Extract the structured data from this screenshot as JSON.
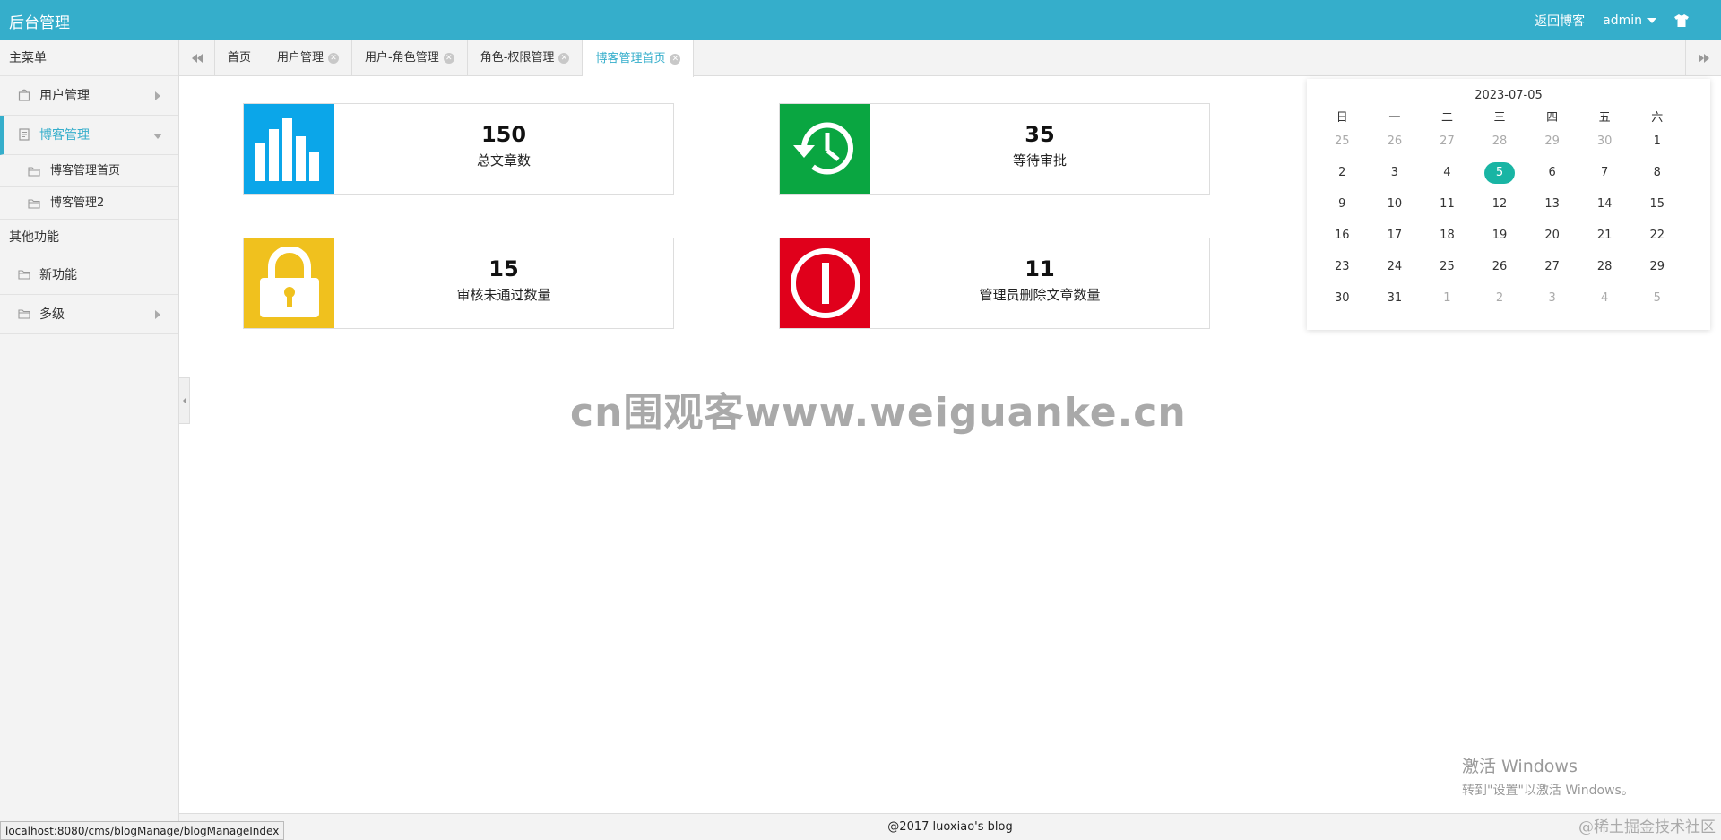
{
  "header": {
    "brand": "后台管理",
    "back_link": "返回博客",
    "user": "admin"
  },
  "sidebar": {
    "main_title": "主菜单",
    "items": [
      {
        "label": "用户管理"
      },
      {
        "label": "博客管理"
      }
    ],
    "blog_sub": [
      {
        "label": "博客管理首页"
      },
      {
        "label": "博客管理2"
      }
    ],
    "other_title": "其他功能",
    "other_items": [
      {
        "label": "新功能"
      },
      {
        "label": "多级"
      }
    ]
  },
  "tabs": [
    {
      "label": "首页"
    },
    {
      "label": "用户管理"
    },
    {
      "label": "用户-角色管理"
    },
    {
      "label": "角色-权限管理"
    },
    {
      "label": "博客管理首页"
    }
  ],
  "stats": [
    {
      "value": "150",
      "label": "总文章数",
      "color": "#0ba6e9"
    },
    {
      "value": "35",
      "label": "等待审批",
      "color": "#0aa641"
    },
    {
      "value": "15",
      "label": "审核未通过数量",
      "color": "#f0c11e"
    },
    {
      "value": "11",
      "label": "管理员删除文章数量",
      "color": "#e0001b"
    }
  ],
  "watermark": "cn围观客www.weiguanke.cn",
  "calendar": {
    "title": "2023-07-05",
    "weekdays": [
      "日",
      "一",
      "二",
      "三",
      "四",
      "五",
      "六"
    ],
    "weeks": [
      [
        "25",
        "26",
        "27",
        "28",
        "29",
        "30",
        "1"
      ],
      [
        "2",
        "3",
        "4",
        "5",
        "6",
        "7",
        "8"
      ],
      [
        "9",
        "10",
        "11",
        "12",
        "13",
        "14",
        "15"
      ],
      [
        "16",
        "17",
        "18",
        "19",
        "20",
        "21",
        "22"
      ],
      [
        "23",
        "24",
        "25",
        "26",
        "27",
        "28",
        "29"
      ],
      [
        "30",
        "31",
        "1",
        "2",
        "3",
        "4",
        "5"
      ]
    ],
    "selected": "5"
  },
  "footer": {
    "copyright": "@2017 luoxiao's blog"
  },
  "status_url": "localhost:8080/cms/blogManage/blogManageIndex",
  "activate": {
    "title": "激活 Windows",
    "hint": "转到\"设置\"以激活 Windows。"
  },
  "juejin": "@稀土掘金技术社区"
}
